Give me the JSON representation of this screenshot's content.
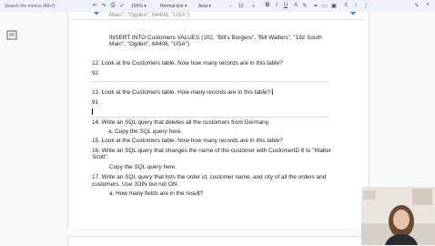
{
  "toolbar": {
    "search_placeholder": "Search the menus (Alt+/)",
    "zoom": "100%",
    "style": "Normal text",
    "font": "Arial",
    "font_size": "12",
    "icons": [
      "undo-icon",
      "redo-icon",
      "print-icon",
      "spellcheck-icon",
      "paint-format-icon",
      "bold-icon",
      "italic-icon",
      "underline-icon",
      "text-color-icon",
      "highlight-icon",
      "link-icon",
      "comment-icon",
      "image-icon",
      "align-icon",
      "line-spacing-icon",
      "more-icon",
      "pen-icon",
      "collapse-icon"
    ]
  },
  "document": {
    "line_top": "Main\", \"Ogden\", 84408, \"USA\")",
    "insert_line1": "INSERT INTO Customers VALUES (102, \"Bill's Burgers\", \"Bill Walters\", \"192 South",
    "insert_line2": "Main\", \"Ogden\", 84408, \"USA\")",
    "q12": "12. Look at the Customers table. Now how many records are in this table?",
    "a12": "92",
    "q13": "13. Look at the Customers table. How many records are in this table?",
    "a13": "91",
    "q14": "14. Write an SQL query that deletes all the customers from Germany.",
    "q14a_pre": "a. Copy the ",
    "q14a_em": "SQL query",
    "q14a_post": " here.",
    "q15_pre": "15. Look at the Customers ",
    "q15_em1": "table",
    "q15_mid": ". Now how many ",
    "q15_em2": "records",
    "q15_mid2": " are in ",
    "q15_em3": "this table",
    "q15_post": "?",
    "q16_line1": "16. Write  an  SQL query that changes the name of the customer with CustomerID 6 to \"Walter",
    "q16_line2": "Scott\".",
    "q16a_pre": "Copy the  ",
    "q16a_em": "SQL query",
    "q16a_post": " here.",
    "q17_line1_pre": "17. Write an ",
    "q17_line1_em": "SQL query",
    "q17_line1_post": " that lists the order id, customer name, and city of all the orders and",
    "q17_line2": "customers. Use JOIN but not ON.",
    "q17a": "a. How many fields are in the result?"
  },
  "colors": {
    "toolbar_bg": "#edf2fa",
    "ruler_marker": "#4285f4",
    "page_bg": "#ffffff",
    "canvas_bg": "#f8f9fa"
  }
}
